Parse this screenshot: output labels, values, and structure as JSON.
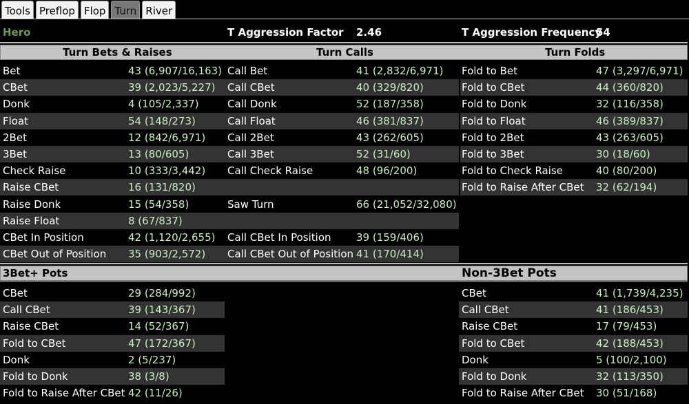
{
  "tabs": [
    "Tools",
    "Preflop",
    "Flop",
    "Turn",
    "River"
  ],
  "active_tab": "Turn",
  "player": "Hero",
  "af_label": "T Aggression Factor",
  "af_value": "2.46",
  "afq_label": "T Aggression Frequency",
  "afq_value": "54",
  "sections": {
    "bets": "Turn Bets & Raises",
    "calls": "Turn Calls",
    "folds": "Turn Folds"
  },
  "rows": [
    {
      "l1": "Bet",
      "v1": "43 (6,907/16,163)",
      "l2": "Call Bet",
      "v2": "41 (2,832/6,971)",
      "l3": "Fold to Bet",
      "v3": "47 (3,297/6,971)"
    },
    {
      "l1": "CBet",
      "v1": "39 (2,023/5,227)",
      "l2": "Call CBet",
      "v2": "40 (329/820)",
      "l3": "Fold to CBet",
      "v3": "44 (360/820)"
    },
    {
      "l1": "Donk",
      "v1": "4 (105/2,337)",
      "l2": "Call Donk",
      "v2": "52 (187/358)",
      "l3": "Fold to Donk",
      "v3": "32 (116/358)"
    },
    {
      "l1": "Float",
      "v1": "54 (148/273)",
      "l2": "Call Float",
      "v2": "46 (381/837)",
      "l3": "Fold to Float",
      "v3": "46 (389/837)"
    },
    {
      "l1": "2Bet",
      "v1": "12 (842/6,971)",
      "l2": "Call 2Bet",
      "v2": "43 (262/605)",
      "l3": "Fold to 2Bet",
      "v3": "43 (263/605)"
    },
    {
      "l1": "3Bet",
      "v1": "13 (80/605)",
      "l2": "Call 3Bet",
      "v2": "52 (31/60)",
      "l3": "Fold to 3Bet",
      "v3": "30 (18/60)"
    },
    {
      "l1": "Check Raise",
      "v1": "10 (333/3,442)",
      "l2": "Call Check Raise",
      "v2": "48 (96/200)",
      "l3": "Fold to Check Raise",
      "v3": "40 (80/200)"
    },
    {
      "l1": "Raise CBet",
      "v1": "16 (131/820)",
      "l2": "",
      "v2": "",
      "l3": "Fold to Raise After CBet",
      "v3": "32 (62/194)"
    },
    {
      "l1": "Raise Donk",
      "v1": "15 (54/358)",
      "l2": "Saw Turn",
      "v2": "66 (21,052/32,080)",
      "l3": "",
      "v3": ""
    },
    {
      "l1": "Raise Float",
      "v1": "8 (67/837)",
      "l2": "",
      "v2": "",
      "l3": "",
      "v3": ""
    },
    {
      "l1": "CBet In Position",
      "v1": "42 (1,120/2,655)",
      "l2": "Call CBet In Position",
      "v2": "39 (159/406)",
      "l3": "",
      "v3": ""
    },
    {
      "l1": "CBet Out of Position",
      "v1": "35 (903/2,572)",
      "l2": "Call CBet Out of Position",
      "v2": "41 (170/414)",
      "l3": "",
      "v3": ""
    }
  ],
  "three_bet": {
    "title": "3Bet+ Pots",
    "rows": [
      {
        "l": "CBet",
        "v": "29 (284/992)"
      },
      {
        "l": "Call CBet",
        "v": "39 (143/367)"
      },
      {
        "l": "Raise CBet",
        "v": "14 (52/367)"
      },
      {
        "l": "Fold to CBet",
        "v": "47 (172/367)"
      },
      {
        "l": "Donk",
        "v": "2 (5/237)"
      },
      {
        "l": "Fold to Donk",
        "v": "38 (3/8)"
      },
      {
        "l": "Fold to Raise After CBet",
        "v": "42 (11/26)"
      }
    ]
  },
  "non_three_bet": {
    "title": "Non-3Bet Pots",
    "rows": [
      {
        "l": "CBet",
        "v": "41 (1,739/4,235)"
      },
      {
        "l": "Call CBet",
        "v": "41 (186/453)"
      },
      {
        "l": "Raise CBet",
        "v": "17 (79/453)"
      },
      {
        "l": "Fold to CBet",
        "v": "42 (188/453)"
      },
      {
        "l": "Donk",
        "v": "5 (100/2,100)"
      },
      {
        "l": "Fold to Donk",
        "v": "32 (113/350)"
      },
      {
        "l": "Fold to Raise After CBet",
        "v": "30 (51/168)"
      }
    ]
  }
}
